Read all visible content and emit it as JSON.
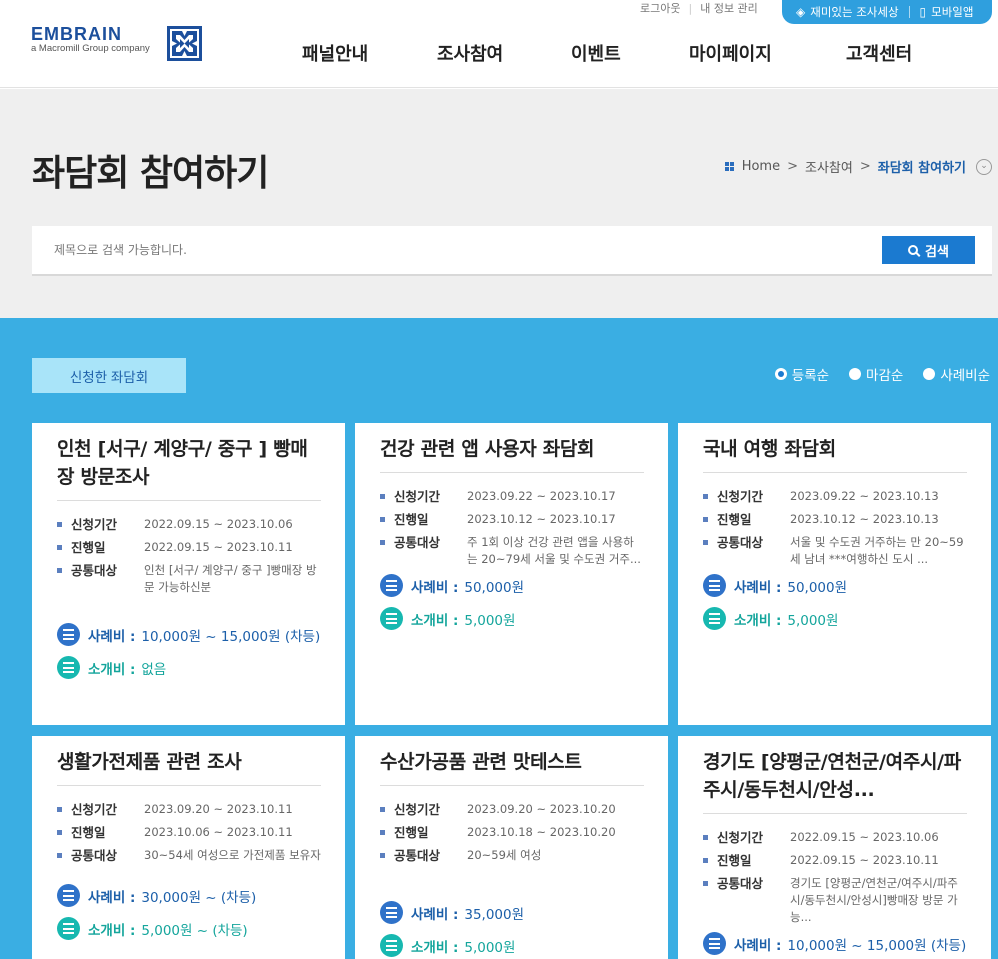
{
  "header": {
    "logo_text": "EMBRAIN",
    "logo_sub": "a Macromill Group company",
    "util_links": [
      "로그아웃",
      "내 정보 관리"
    ],
    "pill_links": [
      "재미있는 조사세상",
      "모바일앱"
    ],
    "nav": [
      "패널안내",
      "조사참여",
      "이벤트",
      "마이페이지",
      "고객센터"
    ]
  },
  "page": {
    "title": "좌담회 참여하기",
    "breadcrumb": [
      "Home",
      "조사참여",
      "좌담회 참여하기"
    ]
  },
  "search": {
    "placeholder": "제목으로 검색 가능합니다.",
    "button": "검색"
  },
  "list": {
    "applied_button": "신청한 좌담회",
    "sort_options": [
      "등록순",
      "마감순",
      "사례비순"
    ],
    "labels": {
      "apply_period": "신청기간",
      "progress_date": "진행일",
      "target": "공통대상",
      "pay": "사례비 :",
      "referral": "소개비 :"
    },
    "cards": [
      {
        "title": "인천 [서구/ 계양구/ 중구 ] 빵매장 방문조사",
        "apply_period": "2022.09.15 ~ 2023.10.06",
        "progress_date": "2022.09.15 ~ 2023.10.11",
        "target": "인천 [서구/ 계양구/ 중구 ]빵매장 방문 가능하신분",
        "pay": "10,000원 ~ 15,000원 (차등)",
        "referral": "없음"
      },
      {
        "title": "건강 관련 앱 사용자 좌담회",
        "apply_period": "2023.09.22 ~ 2023.10.17",
        "progress_date": "2023.10.12 ~ 2023.10.17",
        "target": "주 1회 이상 건강 관련 앱을 사용하는 20~79세 서울 및 수도권 거주...",
        "pay": "50,000원",
        "referral": "5,000원"
      },
      {
        "title": "국내 여행 좌담회",
        "apply_period": "2023.09.22 ~ 2023.10.13",
        "progress_date": "2023.10.12 ~ 2023.10.13",
        "target": "서울 및 수도권 거주하는 만 20~59세 남녀 ***여행하신 도시 ...",
        "pay": "50,000원",
        "referral": "5,000원"
      },
      {
        "title": "생활가전제품 관련 조사",
        "apply_period": "2023.09.20 ~ 2023.10.11",
        "progress_date": "2023.10.06 ~ 2023.10.11",
        "target": "30~54세 여성으로 가전제품 보유자",
        "pay": "30,000원 ~ (차등)",
        "referral": "5,000원 ~ (차등)"
      },
      {
        "title": "수산가공품 관련 맛테스트",
        "apply_period": "2023.09.20 ~ 2023.10.20",
        "progress_date": "2023.10.18 ~ 2023.10.20",
        "target": "20~59세 여성",
        "pay": "35,000원",
        "referral": "5,000원"
      },
      {
        "title": "경기도 [양평군/연천군/여주시/파주시/동두천시/안성...",
        "apply_period": "2022.09.15 ~ 2023.10.06",
        "progress_date": "2022.09.15 ~ 2023.10.11",
        "target": "경기도 [양평군/연천군/여주시/파주시/동두천시/안성시]빵매장 방문 가능...",
        "pay": "10,000원 ~ 15,000원 (차등)",
        "referral": ""
      }
    ]
  },
  "colors": {
    "brand_blue": "#1c4f9c",
    "section_blue": "#3aaee3",
    "button_blue": "#1b7ad0",
    "referral_teal": "#17b8b0"
  }
}
